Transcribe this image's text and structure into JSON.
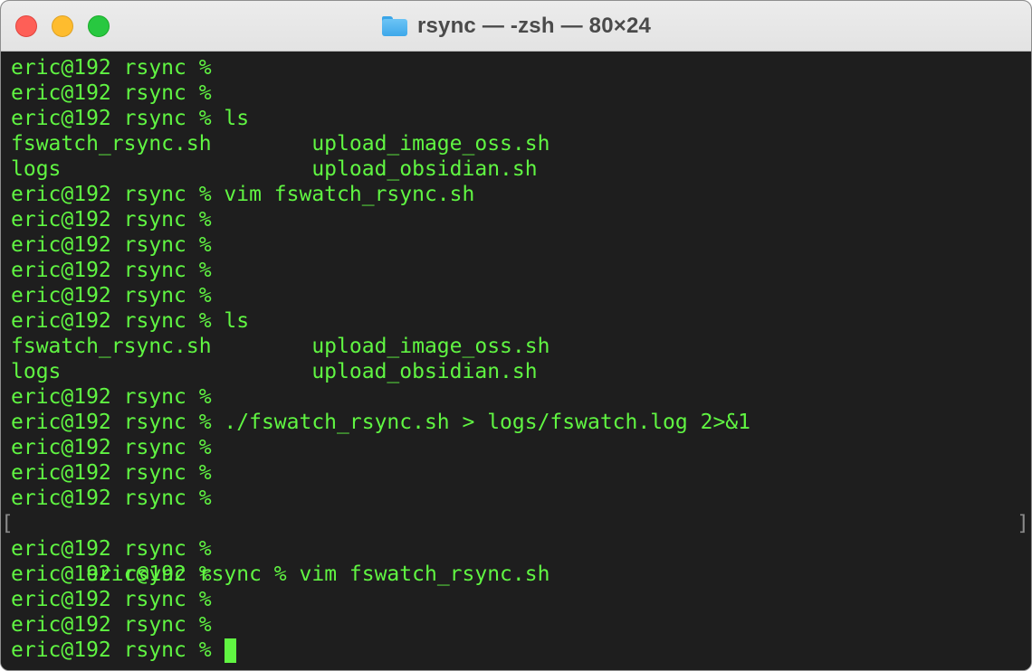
{
  "window": {
    "title": "rsync — -zsh — 80×24",
    "title_icon": "folder-icon"
  },
  "colors": {
    "terminal_background": "#1e1e1e",
    "text": "#60f542",
    "titlebar": "#ececec"
  },
  "terminal": {
    "lines": [
      "eric@192 rsync %",
      "eric@192 rsync %",
      "eric@192 rsync % ls",
      "fswatch_rsync.sh        upload_image_oss.sh",
      "logs                    upload_obsidian.sh",
      "eric@192 rsync % vim fswatch_rsync.sh",
      "eric@192 rsync %",
      "eric@192 rsync %",
      "eric@192 rsync %",
      "eric@192 rsync %",
      "eric@192 rsync % ls",
      "fswatch_rsync.sh        upload_image_oss.sh",
      "logs                    upload_obsidian.sh",
      "eric@192 rsync %",
      "eric@192 rsync % ./fswatch_rsync.sh > logs/fswatch.log 2>&1",
      "eric@192 rsync %",
      "eric@192 rsync %",
      "eric@192 rsync %",
      "eric@192 rsync % vim fswatch_rsync.sh",
      "eric@192 rsync %",
      "eric@192 rsync %",
      "eric@192 rsync %",
      "eric@192 rsync %",
      "eric@192 rsync %"
    ],
    "bracket_left": "[",
    "bracket_right": "]"
  }
}
